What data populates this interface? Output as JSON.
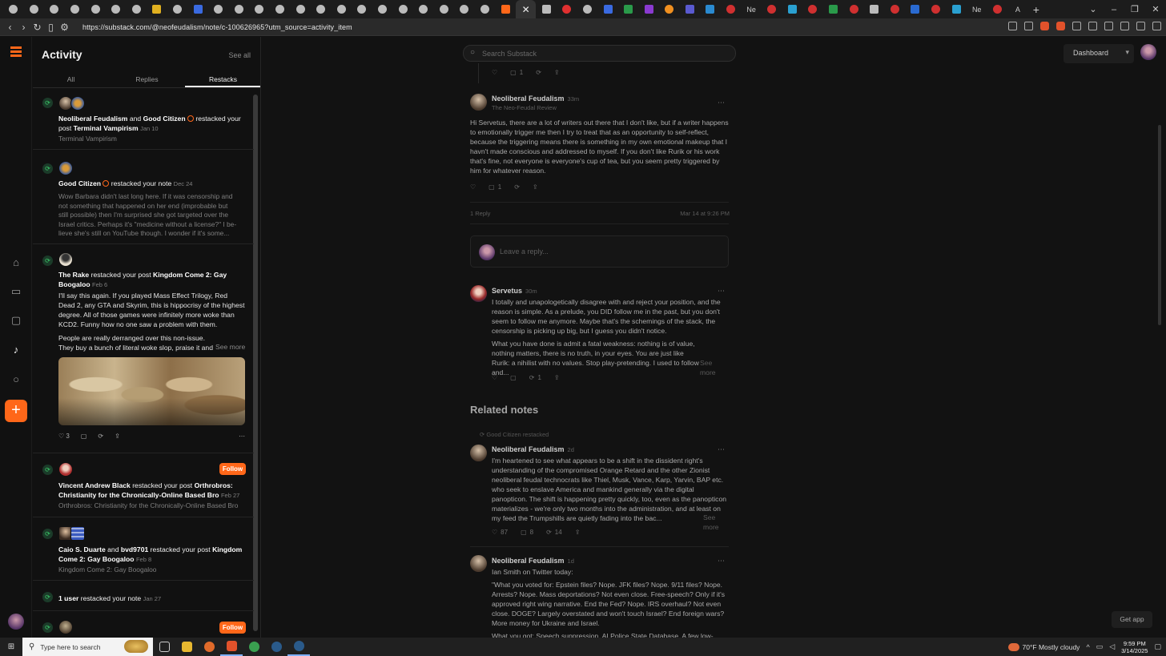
{
  "browser": {
    "url": "https://substack.com/@neofeudalism/note/c-100626965?utm_source=activity_item",
    "tab_text_1": "Ne",
    "tab_text_2": "Ne",
    "tab_text_3": "A",
    "new_tab": "+",
    "controls": [
      "⌄",
      "–",
      "❐",
      "✕"
    ]
  },
  "activity": {
    "title": "Activity",
    "see_all": "See all",
    "tabs": [
      "All",
      "Replies",
      "Restacks"
    ],
    "items": [
      {
        "actor": "Neoliberal Feudalism",
        "joiner": "and",
        "actor2": "Good Citizen",
        "action": "restacked your post",
        "post": "Terminal Vampirism",
        "date": "Jan 10",
        "subtitle": "Terminal Vampirism"
      },
      {
        "actor": "Good Citizen",
        "action": "restacked your note",
        "date": "Dec 24",
        "excerpt": "Wow Barbara didn't last long here. If it was censorship and not something that happened on her end (improbable but still possible) then I'm surprised she got targeted over the Israel critics. Perhaps it's \"medicine without a license?\" I be-lieve she's still on YouTube though. I wonder if it's some..."
      },
      {
        "actor": "The Rake",
        "action": "restacked your post",
        "post": "Kingdom Come 2: Gay Boogaloo",
        "date": "Feb 6",
        "body1": "I'll say this again. If you played Mass Effect Trilogy, Red Dead 2, any GTA and Skyrim, this is hippocrisy of the highest degree. All of those games were infinitely more woke than KCD2. Funny how no one saw a problem with them.",
        "body2": "People are really derranged over this non-issue. They buy a bunch of literal woke slop, praise it and when they",
        "see_more": "See more",
        "likes": "3"
      },
      {
        "actor": "Vincent Andrew Black",
        "action": "restacked your post",
        "post": "Orthrobros: Christianity for the Chronically-Online Based Bro",
        "date": "Feb 27",
        "subtitle": "Orthrobros: Christianity for the Chronically-Online Based Bro",
        "follow": "Follow"
      },
      {
        "actor": "Caio S. Duarte",
        "joiner": "and",
        "actor2": "bvd9701",
        "action": "restacked your post",
        "post": "Kingdom Come 2: Gay Boogaloo",
        "date": "Feb 8",
        "subtitle": "Kingdom Come 2: Gay Boogaloo"
      },
      {
        "actor": "1 user",
        "action": "restacked your note",
        "date": "Jan 27"
      },
      {
        "follow": "Follow"
      }
    ]
  },
  "main": {
    "search_placeholder": "Search Substack",
    "dashboard": "Dashboard",
    "get_app": "Get app",
    "top_actions": {
      "comments": "1"
    },
    "note": {
      "author": "Neoliberal Feudalism",
      "time": "33m",
      "publication": "The Neo-Feudal Review",
      "text": "Hi Servetus, there are a lot of writers out there that I don't like, but if a writer happens to emotionally trigger me then I try to treat that as an opportunity to self-reflect, because the triggering means there is something in my own emotional makeup that I havn't made conscious and addressed to myself. If you don't like Rurik or his work that's fine, not everyone is everyone's cup of tea, but you seem pretty triggered by him for whatever reason.",
      "comments": "1",
      "replies_count": "1 Reply",
      "timestamp": "Mar 14 at 9:26 PM"
    },
    "reply_placeholder": "Leave a reply...",
    "reply": {
      "author": "Servetus",
      "time": "30m",
      "p1": "I totally and unapologetically disagree with and reject your position, and the reason is simple. As a prelude, you DID follow me in the past, but you don't seem to follow me anymore. Maybe that's the schemings of the stack, the censorship is picking up big, but I guess you didn't notice.",
      "p2": "What you have done is admit a fatal weakness: nothing is of value, nothing matters, there is no truth, in your eyes. You are just like Rurik: a nihilist with no values. Stop play-pretending. I used to follow and...",
      "see_more": "See more",
      "restacks": "1"
    },
    "related_title": "Related notes",
    "related": [
      {
        "restacked_by": "Good Citizen restacked",
        "author": "Neoliberal Feudalism",
        "time": "2d",
        "text": "I'm heartened to see what appears to be a shift in the dissident right's understanding of the compromised Orange Retard and the other Zionist neoliberal feudal technocrats like Thiel, Musk, Vance, Karp, Yarvin, BAP etc. who seek to enslave America and mankind generally via the digital panopticon. The shift is happening pretty quickly, too, even as the panopticon materializes - we're only two months into the administration, and at least on my feed the Trumpshills are quietly fading into the bac...",
        "see_more": "See more",
        "likes": "87",
        "comments": "8",
        "restacks": "14"
      },
      {
        "author": "Neoliberal Feudalism",
        "time": "1d",
        "text1": "Ian Smith on Twitter today:",
        "text2": "\"What you voted for: Epstein files? Nope. JFK files? Nope. 9/11 files? Nope. Arrests? Nope. Mass deportations? Not even close. Free-speech? Only if it's approved right wing narrative. End the Fed? Nope. IRS overhaul? Not even close. DOGE? Largely overstated and won't touch Israel? End foreign wars? More money for Ukraine and Israel.",
        "text3": "What you got: Speech suppression. AI Police State Database. A few low-"
      }
    ]
  },
  "taskbar": {
    "search": "Type here to search",
    "weather": "70°F  Mostly cloudy",
    "time": "9:59 PM",
    "date": "3/14/2025"
  },
  "colors": {
    "accent": "#ff6719",
    "restack_green": "#3dd46d"
  }
}
